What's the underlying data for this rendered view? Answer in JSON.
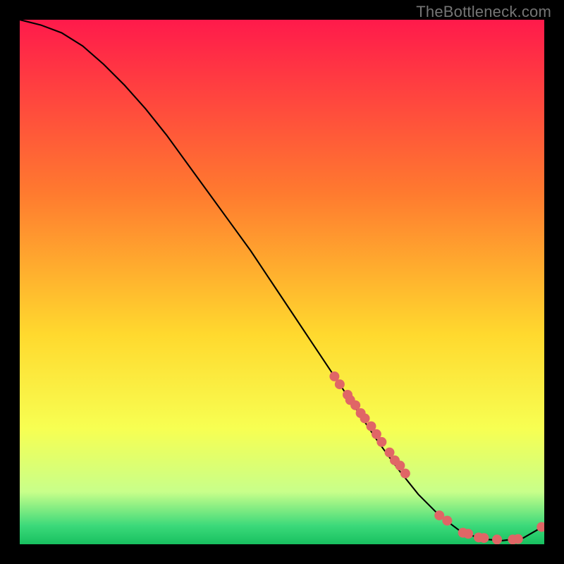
{
  "watermark": "TheBottleneck.com",
  "chart_data": {
    "type": "line",
    "title": "",
    "xlabel": "",
    "ylabel": "",
    "xlim": [
      0,
      100
    ],
    "ylim": [
      0,
      100
    ],
    "grid": false,
    "gradient_stops": [
      {
        "offset": 0,
        "color": "#ff1a4b"
      },
      {
        "offset": 0.33,
        "color": "#ff7a2f"
      },
      {
        "offset": 0.6,
        "color": "#ffd92e"
      },
      {
        "offset": 0.78,
        "color": "#f7ff52"
      },
      {
        "offset": 0.9,
        "color": "#c8ff8a"
      },
      {
        "offset": 0.965,
        "color": "#3bd97a"
      },
      {
        "offset": 1.0,
        "color": "#18c060"
      }
    ],
    "curve": {
      "x": [
        0,
        4,
        8,
        12,
        16,
        20,
        24,
        28,
        32,
        36,
        40,
        44,
        48,
        52,
        56,
        60,
        64,
        68,
        72,
        76,
        80,
        84,
        88,
        92,
        96,
        100
      ],
      "y": [
        100,
        99,
        97.5,
        95,
        91.5,
        87.5,
        83,
        78,
        72.5,
        67,
        61.5,
        56,
        50,
        44,
        38,
        32,
        26,
        20,
        14.5,
        9.5,
        5.5,
        2.5,
        1,
        0.7,
        1.2,
        3.5
      ],
      "color": "#000000",
      "width": 2
    },
    "markers": {
      "x": [
        60,
        61,
        62.5,
        63,
        64,
        65,
        65.8,
        67,
        68,
        69,
        70.5,
        71.5,
        72.5,
        73.5,
        80,
        81.5,
        84.5,
        85.5,
        87.5,
        88.5,
        91,
        94,
        95,
        99.5
      ],
      "y": [
        32,
        30.5,
        28.5,
        27.5,
        26.5,
        25,
        24,
        22.5,
        21,
        19.5,
        17.5,
        16,
        15,
        13.5,
        5.5,
        4.5,
        2.2,
        2.0,
        1.3,
        1.2,
        0.9,
        0.9,
        1.0,
        3.3
      ],
      "color": "#e06666",
      "radius": 7
    }
  }
}
